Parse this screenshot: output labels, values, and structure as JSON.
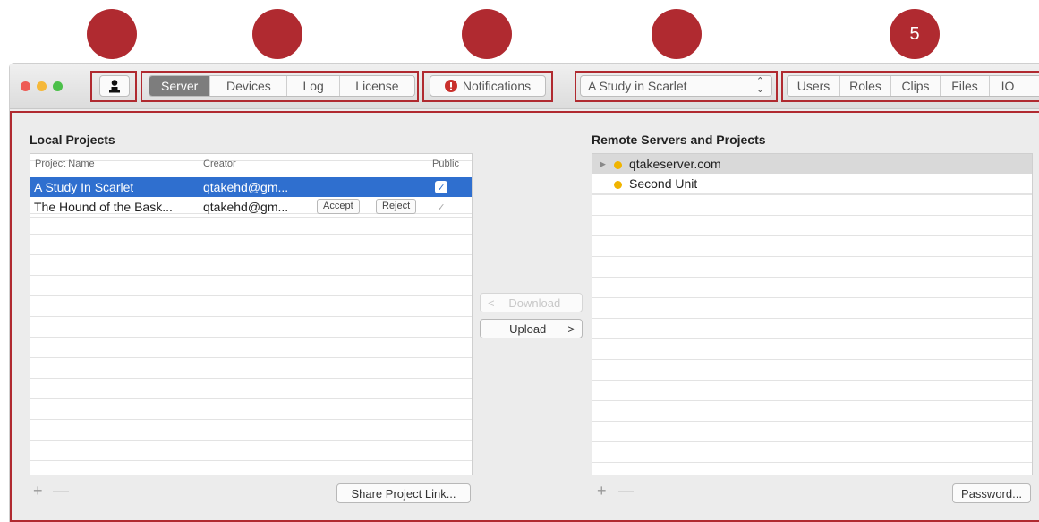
{
  "markers": [
    "",
    "",
    "",
    "",
    "5"
  ],
  "toolbar": {
    "segments": [
      {
        "label": "Server",
        "active": true
      },
      {
        "label": "Devices",
        "active": false
      },
      {
        "label": "Log",
        "active": false
      },
      {
        "label": "License",
        "active": false
      }
    ],
    "notifications_label": "Notifications",
    "project_select_value": "A Study in Scarlet",
    "right_tabs": [
      "Users",
      "Roles",
      "Clips",
      "Files",
      "IO"
    ],
    "user_icon": "user-icon",
    "alert_icon": "alert-icon",
    "colors": {
      "marker": "#b02a30",
      "active_segment": "#7d7d7d",
      "selection": "#2f6fcf"
    }
  },
  "local": {
    "title": "Local Projects",
    "columns": [
      "Project Name",
      "Creator",
      "Public"
    ],
    "rows": [
      {
        "name": "A Study In Scarlet",
        "creator": "qtakehd@gm...",
        "public": true,
        "selected": true
      },
      {
        "name": "The Hound of the Bask...",
        "creator": "qtakehd@gm...",
        "accept": "Accept",
        "reject": "Reject",
        "public": false,
        "selected": false
      }
    ],
    "add": "+",
    "remove": "—",
    "share_button": "Share Project Link..."
  },
  "transfer": {
    "download": "Download",
    "upload": "Upload"
  },
  "remote": {
    "title": "Remote Servers and Projects",
    "items": [
      {
        "label": "qtakeserver.com",
        "expandable": true,
        "selected": true
      },
      {
        "label": "Second Unit",
        "expandable": false,
        "selected": false
      }
    ],
    "add": "+",
    "remove": "—",
    "password_button": "Password..."
  }
}
